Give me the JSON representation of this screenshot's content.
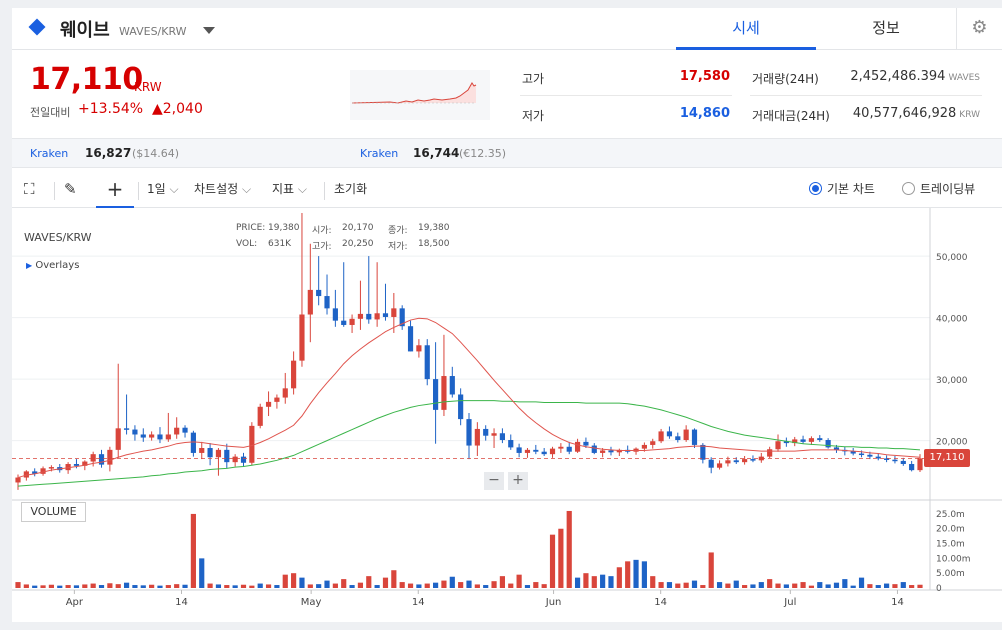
{
  "header": {
    "coin_name": "웨이브",
    "pair": "WAVES/KRW",
    "tabs": [
      "시세",
      "정보"
    ],
    "settings_icon": "gear-icon"
  },
  "ticker": {
    "price": "17,110",
    "currency": "KRW",
    "change_label": "전일대비",
    "change_pct": "+13.54%",
    "change_abs": "▲2,040",
    "high_label": "고가",
    "high": "17,580",
    "low_label": "저가",
    "low": "14,860",
    "volume_label": "거래량(24H)",
    "volume": "2,452,486.394",
    "volume_unit": "WAVES",
    "amount_label": "거래대금(24H)",
    "amount": "40,577,646,928",
    "amount_unit": "KRW"
  },
  "exchanges": [
    {
      "name": "Kraken",
      "price": "16,827",
      "sub": "($14.64)"
    },
    {
      "name": "Kraken",
      "price": "16,744",
      "sub": "(€12.35)"
    }
  ],
  "toolbar": {
    "period": "1일",
    "chart_settings": "차트설정",
    "indicators": "지표",
    "reset": "초기화",
    "basic_chart": "기본 차트",
    "trading_view": "트레이딩뷰"
  },
  "chart_overlay": {
    "symbol": "WAVES/KRW",
    "overlays": "Overlays",
    "price_label": "PRICE:",
    "price": "19,380",
    "vol_label": "VOL:",
    "vol": "631K",
    "open_label": "시가:",
    "open": "20,170",
    "high_label": "고가:",
    "high": "20,250",
    "close_label": "종가:",
    "close": "19,380",
    "low_label": "저가:",
    "low": "18,500",
    "volume_badge": "VOLUME",
    "last_price": "17,110"
  },
  "colors": {
    "up": "#d9453b",
    "down": "#1e63c6",
    "ma_short": "#e0554e",
    "ma_long": "#3bb54a",
    "accent": "#1a5fe0"
  },
  "chart_data": {
    "type": "candlestick",
    "title": "WAVES/KRW",
    "x_tick_labels": [
      "Apr",
      "14",
      "May",
      "14",
      "Jun",
      "14",
      "Jul",
      "14"
    ],
    "y_tick_labels": [
      "50,000",
      "40,000",
      "30,000",
      "20,000"
    ],
    "volume_tick_labels": [
      "25.0m",
      "20.0m",
      "15.0m",
      "10.00m",
      "5.00m",
      "0"
    ],
    "ylim": [
      11000,
      57000
    ],
    "volume_ylim": [
      0,
      27000000
    ],
    "candles": [
      {
        "o": 13200,
        "h": 14500,
        "l": 12000,
        "c": 14000
      },
      {
        "o": 14000,
        "h": 15200,
        "l": 13500,
        "c": 15000
      },
      {
        "o": 15000,
        "h": 15500,
        "l": 14200,
        "c": 14600
      },
      {
        "o": 14600,
        "h": 15800,
        "l": 14300,
        "c": 15500
      },
      {
        "o": 15500,
        "h": 16000,
        "l": 15000,
        "c": 15700
      },
      {
        "o": 15700,
        "h": 16200,
        "l": 14800,
        "c": 15200
      },
      {
        "o": 15200,
        "h": 16500,
        "l": 14600,
        "c": 16200
      },
      {
        "o": 16200,
        "h": 17000,
        "l": 15500,
        "c": 15900
      },
      {
        "o": 15900,
        "h": 16800,
        "l": 15200,
        "c": 16600
      },
      {
        "o": 16600,
        "h": 18200,
        "l": 15800,
        "c": 17800
      },
      {
        "o": 17800,
        "h": 18500,
        "l": 15600,
        "c": 16100
      },
      {
        "o": 16100,
        "h": 19000,
        "l": 15000,
        "c": 18500
      },
      {
        "o": 18500,
        "h": 32500,
        "l": 17200,
        "c": 22000
      },
      {
        "o": 22000,
        "h": 27500,
        "l": 21000,
        "c": 21800
      },
      {
        "o": 21800,
        "h": 22500,
        "l": 20000,
        "c": 21000
      },
      {
        "o": 21000,
        "h": 22000,
        "l": 19800,
        "c": 20500
      },
      {
        "o": 20500,
        "h": 21500,
        "l": 20000,
        "c": 21000
      },
      {
        "o": 21000,
        "h": 22200,
        "l": 19600,
        "c": 20200
      },
      {
        "o": 20200,
        "h": 24500,
        "l": 19800,
        "c": 21000
      },
      {
        "o": 21000,
        "h": 23800,
        "l": 20300,
        "c": 22100
      },
      {
        "o": 22100,
        "h": 22500,
        "l": 20500,
        "c": 21300
      },
      {
        "o": 21300,
        "h": 21600,
        "l": 17400,
        "c": 18000
      },
      {
        "o": 18000,
        "h": 19800,
        "l": 17000,
        "c": 18800
      },
      {
        "o": 18800,
        "h": 19600,
        "l": 16000,
        "c": 17300
      },
      {
        "o": 17300,
        "h": 18800,
        "l": 14300,
        "c": 18500
      },
      {
        "o": 18500,
        "h": 19500,
        "l": 15500,
        "c": 16500
      },
      {
        "o": 16500,
        "h": 17800,
        "l": 15800,
        "c": 17400
      },
      {
        "o": 17400,
        "h": 18000,
        "l": 15800,
        "c": 16400
      },
      {
        "o": 16400,
        "h": 23000,
        "l": 16000,
        "c": 22400
      },
      {
        "o": 22400,
        "h": 26000,
        "l": 22000,
        "c": 25500
      },
      {
        "o": 25500,
        "h": 28000,
        "l": 24000,
        "c": 26300
      },
      {
        "o": 26300,
        "h": 27500,
        "l": 25200,
        "c": 27000
      },
      {
        "o": 27000,
        "h": 31000,
        "l": 26000,
        "c": 28500
      },
      {
        "o": 28500,
        "h": 34500,
        "l": 27500,
        "c": 33000
      },
      {
        "o": 33000,
        "h": 57000,
        "l": 32000,
        "c": 40500
      },
      {
        "o": 40500,
        "h": 52000,
        "l": 36000,
        "c": 44500
      },
      {
        "o": 44500,
        "h": 50000,
        "l": 42000,
        "c": 43500
      },
      {
        "o": 43500,
        "h": 47000,
        "l": 40500,
        "c": 41500
      },
      {
        "o": 41500,
        "h": 44500,
        "l": 38500,
        "c": 39500
      },
      {
        "o": 39500,
        "h": 49000,
        "l": 38500,
        "c": 38800
      },
      {
        "o": 38800,
        "h": 40500,
        "l": 37500,
        "c": 39800
      },
      {
        "o": 39800,
        "h": 46000,
        "l": 38000,
        "c": 40600
      },
      {
        "o": 40600,
        "h": 50000,
        "l": 39000,
        "c": 39700
      },
      {
        "o": 39700,
        "h": 49000,
        "l": 38500,
        "c": 40700
      },
      {
        "o": 40700,
        "h": 45500,
        "l": 39500,
        "c": 40100
      },
      {
        "o": 40100,
        "h": 44000,
        "l": 37500,
        "c": 41500
      },
      {
        "o": 41500,
        "h": 42000,
        "l": 38000,
        "c": 38600
      },
      {
        "o": 38600,
        "h": 39500,
        "l": 34500,
        "c": 34500
      },
      {
        "o": 34500,
        "h": 36500,
        "l": 33500,
        "c": 35500
      },
      {
        "o": 35500,
        "h": 36500,
        "l": 29000,
        "c": 30000
      },
      {
        "o": 30000,
        "h": 36000,
        "l": 19500,
        "c": 25000
      },
      {
        "o": 25000,
        "h": 37200,
        "l": 24000,
        "c": 30500
      },
      {
        "o": 30500,
        "h": 32000,
        "l": 27000,
        "c": 27500
      },
      {
        "o": 27500,
        "h": 28500,
        "l": 22500,
        "c": 23500
      },
      {
        "o": 23500,
        "h": 24500,
        "l": 17000,
        "c": 19200
      },
      {
        "o": 19200,
        "h": 23000,
        "l": 17500,
        "c": 21900
      },
      {
        "o": 21900,
        "h": 22500,
        "l": 20000,
        "c": 20800
      },
      {
        "o": 20800,
        "h": 22000,
        "l": 18800,
        "c": 21200
      },
      {
        "o": 21200,
        "h": 22000,
        "l": 19600,
        "c": 20100
      },
      {
        "o": 20100,
        "h": 21000,
        "l": 18500,
        "c": 18900
      },
      {
        "o": 18900,
        "h": 19500,
        "l": 17300,
        "c": 18000
      },
      {
        "o": 18000,
        "h": 18800,
        "l": 17200,
        "c": 18500
      },
      {
        "o": 18500,
        "h": 19300,
        "l": 17800,
        "c": 18200
      },
      {
        "o": 18200,
        "h": 18800,
        "l": 17500,
        "c": 17800
      },
      {
        "o": 17800,
        "h": 19000,
        "l": 17200,
        "c": 18700
      },
      {
        "o": 18700,
        "h": 19600,
        "l": 18000,
        "c": 19000
      },
      {
        "o": 19000,
        "h": 19800,
        "l": 17800,
        "c": 18200
      },
      {
        "o": 18200,
        "h": 20300,
        "l": 18000,
        "c": 19800
      },
      {
        "o": 19800,
        "h": 20500,
        "l": 18800,
        "c": 19200
      },
      {
        "o": 19200,
        "h": 19600,
        "l": 17800,
        "c": 18000
      },
      {
        "o": 18000,
        "h": 18800,
        "l": 17300,
        "c": 18400
      },
      {
        "o": 18400,
        "h": 19000,
        "l": 17600,
        "c": 18100
      },
      {
        "o": 18100,
        "h": 18700,
        "l": 17500,
        "c": 18500
      },
      {
        "o": 18500,
        "h": 19200,
        "l": 17900,
        "c": 18200
      },
      {
        "o": 18200,
        "h": 18900,
        "l": 17700,
        "c": 18700
      },
      {
        "o": 18700,
        "h": 19700,
        "l": 18200,
        "c": 19300
      },
      {
        "o": 19300,
        "h": 20300,
        "l": 18700,
        "c": 19900
      },
      {
        "o": 19900,
        "h": 21900,
        "l": 19600,
        "c": 21500
      },
      {
        "o": 21500,
        "h": 22300,
        "l": 20300,
        "c": 20700
      },
      {
        "o": 20700,
        "h": 21300,
        "l": 19700,
        "c": 20100
      },
      {
        "o": 20100,
        "h": 22500,
        "l": 19800,
        "c": 21800
      },
      {
        "o": 21800,
        "h": 22000,
        "l": 18800,
        "c": 19300
      },
      {
        "o": 19300,
        "h": 19600,
        "l": 16300,
        "c": 16900
      },
      {
        "o": 16900,
        "h": 17300,
        "l": 14700,
        "c": 15600
      },
      {
        "o": 15600,
        "h": 16800,
        "l": 15300,
        "c": 16300
      },
      {
        "o": 16300,
        "h": 17400,
        "l": 15800,
        "c": 16800
      },
      {
        "o": 16800,
        "h": 17300,
        "l": 16200,
        "c": 16500
      },
      {
        "o": 16500,
        "h": 17500,
        "l": 16100,
        "c": 17000
      },
      {
        "o": 17000,
        "h": 17600,
        "l": 16500,
        "c": 16800
      },
      {
        "o": 16800,
        "h": 18000,
        "l": 16400,
        "c": 17400
      },
      {
        "o": 17400,
        "h": 19000,
        "l": 17100,
        "c": 18600
      },
      {
        "o": 18600,
        "h": 21000,
        "l": 18200,
        "c": 19900
      },
      {
        "o": 19900,
        "h": 20500,
        "l": 19000,
        "c": 19600
      },
      {
        "o": 19600,
        "h": 20600,
        "l": 19100,
        "c": 20200
      },
      {
        "o": 20200,
        "h": 20800,
        "l": 19500,
        "c": 19800
      },
      {
        "o": 19800,
        "h": 20700,
        "l": 19300,
        "c": 20400
      },
      {
        "o": 20400,
        "h": 20900,
        "l": 19800,
        "c": 20100
      },
      {
        "o": 20100,
        "h": 20400,
        "l": 18700,
        "c": 18900
      },
      {
        "o": 18900,
        "h": 19300,
        "l": 18000,
        "c": 18500
      },
      {
        "o": 18500,
        "h": 19000,
        "l": 17600,
        "c": 18300
      },
      {
        "o": 18300,
        "h": 18800,
        "l": 17600,
        "c": 17900
      },
      {
        "o": 17900,
        "h": 18400,
        "l": 17300,
        "c": 17700
      },
      {
        "o": 17700,
        "h": 18200,
        "l": 17000,
        "c": 17400
      },
      {
        "o": 17400,
        "h": 17900,
        "l": 16800,
        "c": 17100
      },
      {
        "o": 17100,
        "h": 17600,
        "l": 16500,
        "c": 16900
      },
      {
        "o": 16900,
        "h": 17500,
        "l": 16300,
        "c": 16700
      },
      {
        "o": 16700,
        "h": 17200,
        "l": 15900,
        "c": 16200
      },
      {
        "o": 16200,
        "h": 16700,
        "l": 15000,
        "c": 15200
      },
      {
        "o": 15200,
        "h": 17800,
        "l": 14900,
        "c": 17110
      }
    ],
    "ma_short": [
      14000,
      14400,
      14600,
      14900,
      15200,
      15400,
      15600,
      15800,
      16000,
      16300,
      16500,
      16800,
      17300,
      17700,
      18000,
      18300,
      18500,
      18800,
      19100,
      19500,
      19700,
      19800,
      19700,
      19500,
      19300,
      19100,
      19000,
      18900,
      19200,
      19700,
      20300,
      21000,
      21700,
      22500,
      24000,
      26000,
      27800,
      29400,
      30900,
      32500,
      33800,
      34900,
      35900,
      36800,
      37700,
      38400,
      39000,
      39600,
      39900,
      39800,
      39200,
      38300,
      37400,
      36000,
      34500,
      33000,
      31400,
      29800,
      28300,
      26800,
      25300,
      24000,
      22900,
      21900,
      21000,
      20300,
      19700,
      19300,
      19000,
      18800,
      18600,
      18500,
      18400,
      18400,
      18400,
      18400,
      18500,
      18600,
      18700,
      18900,
      19000,
      19100,
      19100,
      19000,
      18800,
      18700,
      18600,
      18500,
      18400,
      18300,
      18300,
      18300,
      18300,
      18300,
      18400,
      18500,
      18500,
      18500,
      18500,
      18400,
      18300,
      18200,
      18000,
      17900,
      17700,
      17600,
      17500,
      17400,
      17300
    ],
    "ma_long": [
      12600,
      12700,
      12800,
      12900,
      13000,
      13100,
      13200,
      13300,
      13400,
      13500,
      13600,
      13700,
      13800,
      13900,
      14000,
      14100,
      14300,
      14400,
      14600,
      14700,
      14900,
      15000,
      15100,
      15300,
      15400,
      15500,
      15700,
      15800,
      16000,
      16200,
      16500,
      16800,
      17200,
      17600,
      18200,
      18800,
      19400,
      20000,
      20600,
      21200,
      21800,
      22400,
      23000,
      23600,
      24100,
      24600,
      25000,
      25400,
      25700,
      25900,
      26100,
      26300,
      26400,
      26500,
      26500,
      26500,
      26500,
      26500,
      26400,
      26400,
      26300,
      26300,
      26300,
      26200,
      26200,
      26200,
      26200,
      26200,
      26100,
      26100,
      26100,
      26100,
      26100,
      26000,
      25800,
      25600,
      25300,
      25000,
      24600,
      24200,
      23800,
      23300,
      22800,
      22300,
      21900,
      21500,
      21200,
      20900,
      20700,
      20500,
      20300,
      20100,
      19900,
      19700,
      19500,
      19400,
      19300,
      19200,
      19100,
      19000,
      19000,
      18900,
      18900,
      18800,
      18800,
      18700,
      18700,
      18600,
      18500
    ],
    "volume": [
      2.0,
      1.2,
      0.8,
      0.9,
      1.1,
      0.8,
      1.0,
      0.9,
      1.2,
      1.5,
      1.0,
      1.6,
      1.3,
      1.8,
      1.0,
      0.9,
      1.1,
      0.8,
      1.0,
      1.3,
      1.1,
      25.0,
      10.0,
      1.5,
      1.2,
      1.0,
      0.9,
      1.1,
      0.8,
      1.5,
      1.2,
      1.0,
      4.5,
      5.0,
      3.5,
      1.2,
      1.3,
      2.5,
      1.5,
      3.0,
      1.0,
      1.8,
      4.0,
      1.0,
      3.5,
      6.0,
      2.0,
      1.5,
      1.2,
      1.5,
      1.8,
      2.5,
      3.8,
      2.0,
      2.5,
      1.2,
      1.0,
      2.3,
      4.0,
      1.5,
      4.5,
      1.0,
      2.0,
      1.3,
      18.0,
      20.0,
      26.0,
      3.5,
      5.0,
      4.0,
      4.5,
      4.0,
      7.0,
      9.0,
      9.5,
      9.0,
      4.0,
      2.0,
      2.0,
      1.5,
      1.8,
      2.5,
      1.0,
      12.0,
      2.0,
      1.5,
      2.5,
      1.0,
      1.2,
      2.0,
      3.0,
      1.5,
      1.2,
      1.5,
      2.0,
      0.8,
      2.0,
      1.2,
      1.8,
      3.0,
      0.8,
      3.5,
      1.3,
      1.0,
      1.5,
      1.3,
      2.0,
      1.0,
      1.1
    ],
    "volume_up": [
      true,
      true,
      false,
      true,
      true,
      false,
      true,
      false,
      true,
      true,
      false,
      true,
      true,
      false,
      false,
      false,
      true,
      false,
      true,
      true,
      false,
      true,
      false,
      true,
      false,
      true,
      false,
      true,
      true,
      false,
      true,
      false,
      true,
      true,
      false,
      true,
      false,
      false,
      true,
      true,
      false,
      true,
      true,
      false,
      true,
      true,
      true,
      true,
      false,
      true,
      false,
      true,
      false,
      true,
      false,
      true,
      false,
      true,
      true,
      true,
      true,
      false,
      true,
      true,
      true,
      true,
      true,
      false,
      true,
      true,
      false,
      false,
      true,
      true,
      false,
      false,
      true,
      true,
      false,
      true,
      true,
      false,
      true,
      true,
      false,
      true,
      false,
      true,
      false,
      false,
      true,
      true,
      false,
      true,
      true,
      true,
      false,
      false,
      false,
      false,
      false,
      false,
      true,
      false,
      false,
      true,
      false,
      true,
      true
    ],
    "grid": true
  }
}
